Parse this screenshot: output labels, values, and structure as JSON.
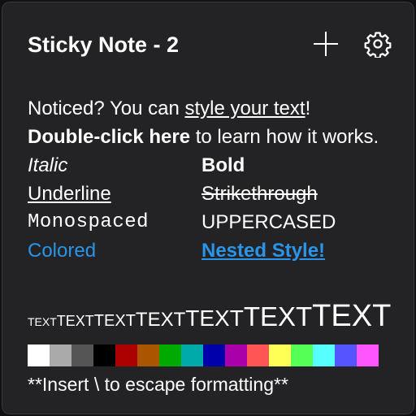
{
  "note": {
    "title": "Sticky Note - 2",
    "icons": {
      "add": "plus-icon",
      "settings": "gear-icon"
    },
    "intro": {
      "p1": "Noticed? You can ",
      "p1_link": "style your text",
      "p1_end": "!",
      "p2_bold": "Double-click here",
      "p2_rest": " to learn how it works."
    },
    "styles": {
      "italic": "Italic",
      "bold": "Bold",
      "underline": "Underline",
      "strikethrough": "Strikethrough",
      "monospaced": "Monospaced",
      "uppercased": "UPPERCASED",
      "colored": "Colored",
      "nested": "Nested Style!"
    },
    "sizes": [
      "TEXT",
      "TEXT",
      "TEXT",
      "TEXT",
      "TEXT",
      "TEXT",
      "TEXT"
    ],
    "colors": [
      "#ffffff",
      "#aaaaaa",
      "#555555",
      "#000000",
      "#aa0000",
      "#aa5500",
      "#00aa00",
      "#00aaaa",
      "#0000aa",
      "#aa00aa",
      "#ff5555",
      "#ffff55",
      "#55ff55",
      "#55ffff",
      "#5555ff",
      "#ff55ff"
    ],
    "accent_color": "#2a95e8",
    "footer": "**Insert \\ to escape formatting**"
  }
}
